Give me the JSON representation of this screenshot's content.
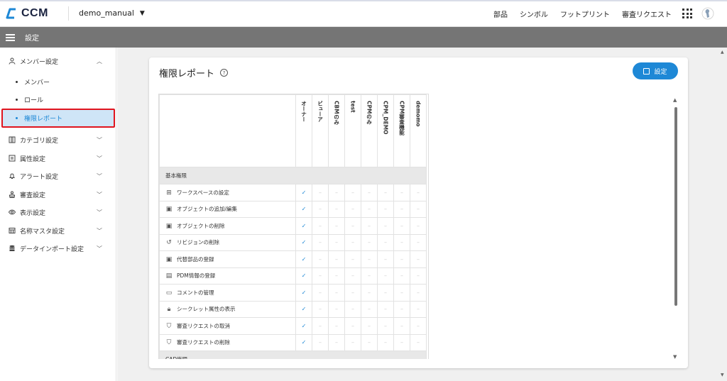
{
  "app": {
    "logo_text": "CCM",
    "project": "demo_manual"
  },
  "topnav": [
    "部品",
    "シンボル",
    "フットプリント",
    "審査リクエスト"
  ],
  "subbar": {
    "title": "設定"
  },
  "sidebar": {
    "items": [
      {
        "label": "メンバー設定",
        "icon": "person-icon",
        "chev": "^"
      },
      {
        "label": "カテゴリ設定",
        "icon": "category-icon",
        "chev": "v"
      },
      {
        "label": "属性設定",
        "icon": "attribute-icon",
        "chev": "v"
      },
      {
        "label": "アラート設定",
        "icon": "bell-icon",
        "chev": "v"
      },
      {
        "label": "審査設定",
        "icon": "stamp-icon",
        "chev": "v"
      },
      {
        "label": "表示設定",
        "icon": "eye-icon",
        "chev": "v"
      },
      {
        "label": "名称マスタ設定",
        "icon": "table-icon",
        "chev": "v"
      },
      {
        "label": "データインポート設定",
        "icon": "database-icon",
        "chev": "v"
      }
    ],
    "subitems": [
      "メンバー",
      "ロール",
      "権限レポート"
    ]
  },
  "card": {
    "title": "権限レポート",
    "settings_label": "設定"
  },
  "table": {
    "columns": [
      "オーナー",
      "ビューア",
      "CBMのみ",
      "test",
      "CPMのみ",
      "CPM_DEMO",
      "CPM審査機能",
      "demomo"
    ],
    "sections": [
      {
        "name": "基本権限",
        "rows": [
          {
            "label": "ワークスペースの設定",
            "icon": "grid-icon"
          },
          {
            "label": "オブジェクトの追加/編集",
            "icon": "chip-icon"
          },
          {
            "label": "オブジェクトの削除",
            "icon": "chip-icon"
          },
          {
            "label": "リビジョンの削除",
            "icon": "history-icon"
          },
          {
            "label": "代替部品の登録",
            "icon": "chip-icon"
          },
          {
            "label": "PDM情報の登録",
            "icon": "document-icon"
          },
          {
            "label": "コメントの管理",
            "icon": "comment-icon"
          },
          {
            "label": "シークレット属性の表示",
            "icon": "lock-icon"
          },
          {
            "label": "審査リクエストの取消",
            "icon": "stamp-icon"
          },
          {
            "label": "審査リクエストの削除",
            "icon": "stamp-icon"
          }
        ]
      },
      {
        "name": "CAD権限",
        "rows": []
      }
    ],
    "check_mark": "✓",
    "dash_mark": "–"
  }
}
